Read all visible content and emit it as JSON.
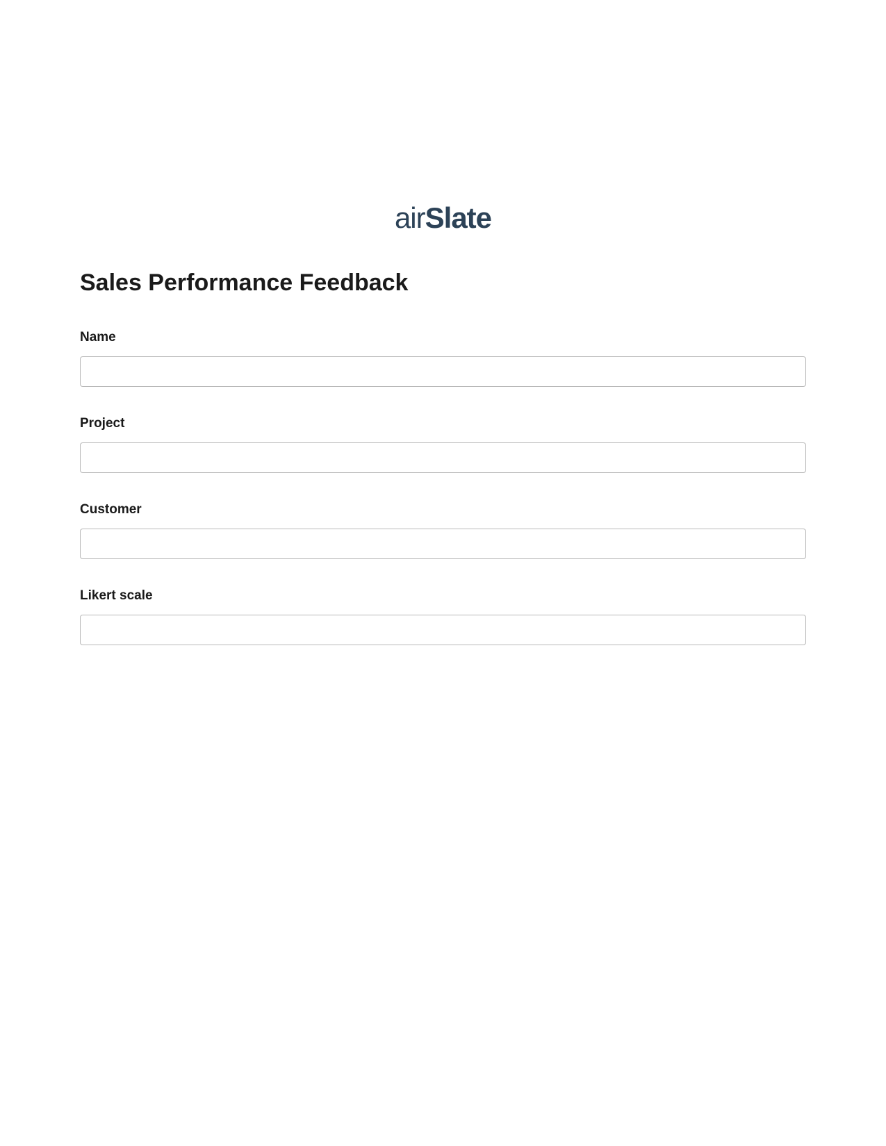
{
  "logo": {
    "part1": "air",
    "part2": "Slate"
  },
  "form": {
    "title": "Sales Performance Feedback",
    "fields": [
      {
        "label": "Name",
        "value": ""
      },
      {
        "label": "Project",
        "value": ""
      },
      {
        "label": "Customer",
        "value": ""
      },
      {
        "label": "Likert scale",
        "value": ""
      }
    ]
  }
}
